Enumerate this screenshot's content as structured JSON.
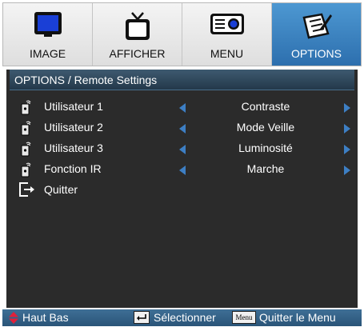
{
  "tabs": [
    {
      "label": "IMAGE",
      "icon": "monitor-icon",
      "active": false
    },
    {
      "label": "AFFICHER",
      "icon": "tv-icon",
      "active": false
    },
    {
      "label": "MENU",
      "icon": "projector-icon",
      "active": false
    },
    {
      "label": "OPTIONS",
      "icon": "notepad-icon",
      "active": true
    }
  ],
  "panel": {
    "title": "OPTIONS / Remote Settings",
    "rows": [
      {
        "label": "Utilisateur 1",
        "value": "Contraste",
        "icon": "remote-icon"
      },
      {
        "label": "Utilisateur 2",
        "value": "Mode Veille",
        "icon": "remote-icon"
      },
      {
        "label": "Utilisateur 3",
        "value": "Luminosité",
        "icon": "remote-icon"
      },
      {
        "label": "Fonction IR",
        "value": "Marche",
        "icon": "remote-icon"
      },
      {
        "label": "Quitter",
        "icon": "exit-icon"
      }
    ]
  },
  "footer": {
    "updown_label": "Haut Bas",
    "enter_label": "Sélectionner",
    "menu_key": "Menu",
    "menu_label": "Quitter le Menu"
  },
  "colors": {
    "accent": "#3d7fc4",
    "panel_bg": "#2b2b2b",
    "active_tab": "#2d6fae",
    "updown_arrow": "#e0203a"
  }
}
